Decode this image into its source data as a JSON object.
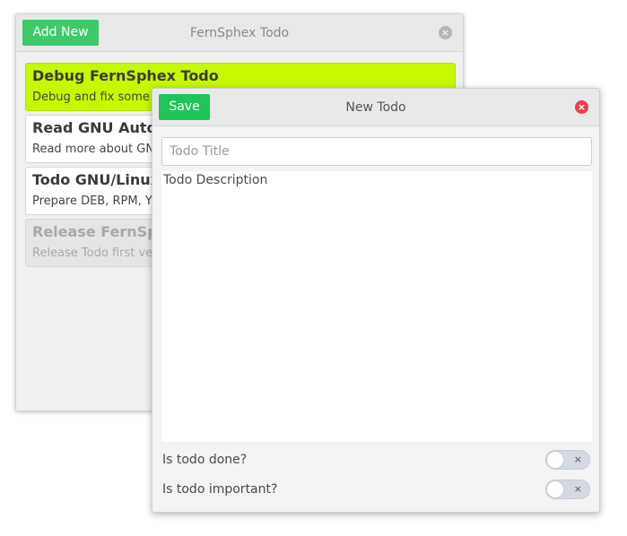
{
  "main_window": {
    "title": "FernSphex Todo",
    "add_new_label": "Add New",
    "close_glyph": "×",
    "todos": [
      {
        "title": "Debug FernSphex Todo",
        "description": "Debug and fix some issues in FernSphex Todo",
        "state": "important"
      },
      {
        "title": "Read GNU Autotools",
        "description": "Read more about GNU Autotools",
        "state": "normal"
      },
      {
        "title": "Todo GNU/Linux packages",
        "description": "Prepare DEB, RPM, YUM packages",
        "state": "normal"
      },
      {
        "title": "Release FernSphex Todo",
        "description": "Release Todo first version",
        "state": "done"
      }
    ]
  },
  "dialog": {
    "title": "New Todo",
    "save_label": "Save",
    "close_glyph": "×",
    "title_placeholder": "Todo Title",
    "title_value": "",
    "description_placeholder": "Todo Description",
    "options": [
      {
        "label": "Is todo done?",
        "value": false,
        "toggle_glyph": "×"
      },
      {
        "label": "Is todo important?",
        "value": false,
        "toggle_glyph": "×"
      }
    ]
  },
  "colors": {
    "accent_green": "#2ecc71",
    "important_highlight": "#c6f800",
    "close_red": "#e8404c"
  },
  "icons": {
    "main_close": "close-circle-icon",
    "dialog_close": "close-circle-icon",
    "toggle_off": "x-icon"
  }
}
